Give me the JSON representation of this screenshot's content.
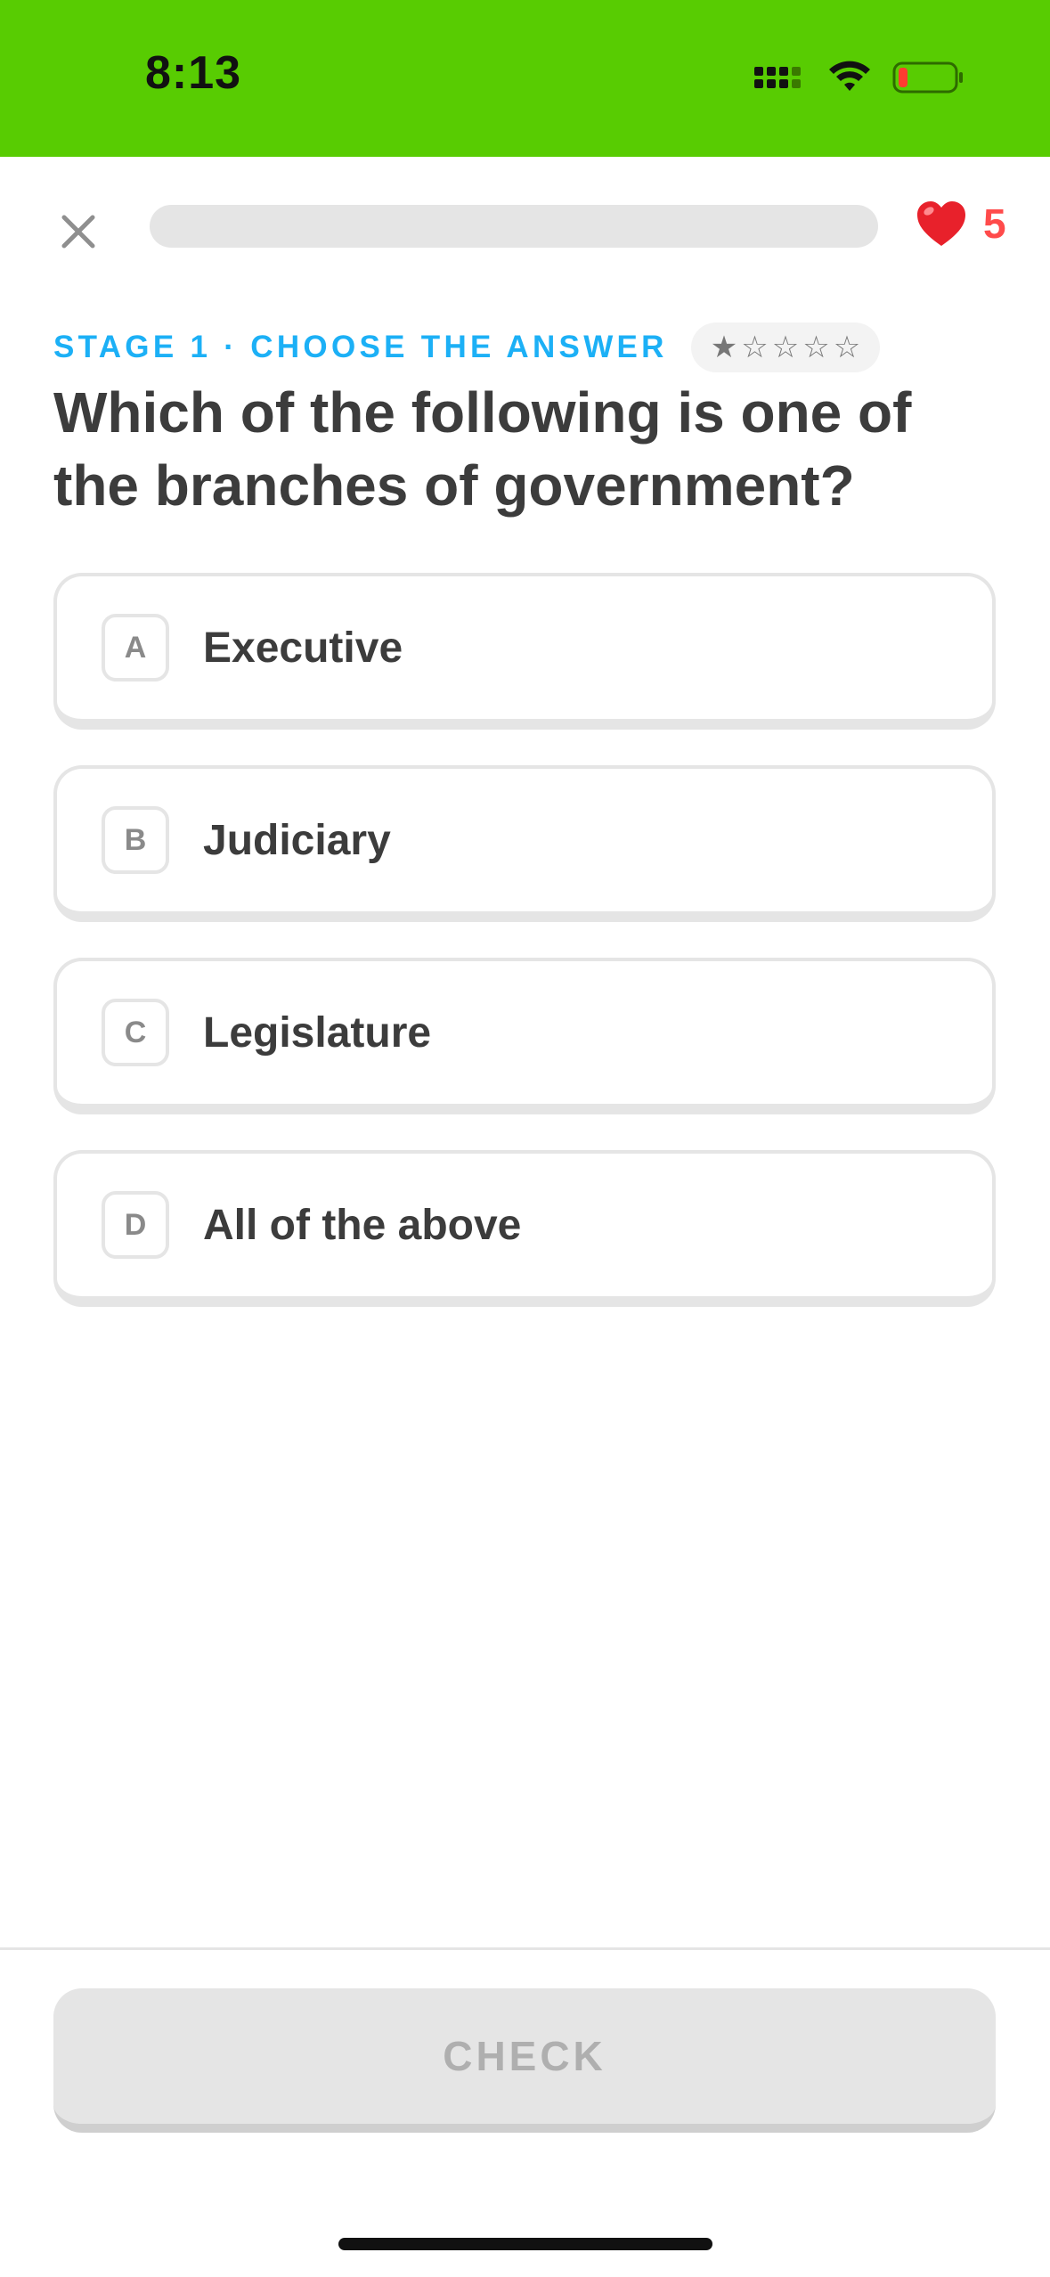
{
  "status_bar": {
    "time": "8:13",
    "background_color": "#58cc02",
    "icons": [
      "cellular-signal-icon",
      "wifi-icon",
      "battery-low-icon"
    ]
  },
  "lesson_header": {
    "close_icon": "close-icon",
    "progress": 0,
    "hearts_icon": "heart-icon",
    "hearts_count": "5"
  },
  "challenge": {
    "stage_label": "STAGE 1 · CHOOSE THE ANSWER",
    "difficulty_stars": {
      "filled": 1,
      "total": 5
    },
    "question": "Which of the following is one of the branches of government?",
    "options": [
      {
        "key": "A",
        "text": "Executive"
      },
      {
        "key": "B",
        "text": "Judiciary"
      },
      {
        "key": "C",
        "text": "Legislature"
      },
      {
        "key": "D",
        "text": "All of the above"
      }
    ]
  },
  "footer": {
    "check_label": "CHECK"
  },
  "colors": {
    "accent_green": "#58cc02",
    "stage_blue": "#1cb0f6",
    "heart_red": "#ff4b4b",
    "border_gray": "#e5e5e5",
    "text_dark": "#3c3c3c"
  }
}
